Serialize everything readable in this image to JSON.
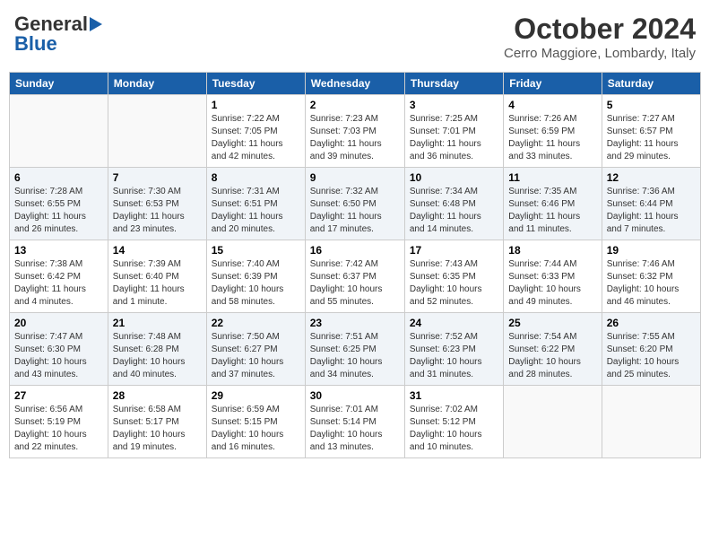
{
  "logo": {
    "general": "General",
    "blue": "Blue"
  },
  "title": "October 2024",
  "subtitle": "Cerro Maggiore, Lombardy, Italy",
  "days_header": [
    "Sunday",
    "Monday",
    "Tuesday",
    "Wednesday",
    "Thursday",
    "Friday",
    "Saturday"
  ],
  "weeks": [
    [
      {
        "num": "",
        "info": ""
      },
      {
        "num": "",
        "info": ""
      },
      {
        "num": "1",
        "info": "Sunrise: 7:22 AM\nSunset: 7:05 PM\nDaylight: 11 hours\nand 42 minutes."
      },
      {
        "num": "2",
        "info": "Sunrise: 7:23 AM\nSunset: 7:03 PM\nDaylight: 11 hours\nand 39 minutes."
      },
      {
        "num": "3",
        "info": "Sunrise: 7:25 AM\nSunset: 7:01 PM\nDaylight: 11 hours\nand 36 minutes."
      },
      {
        "num": "4",
        "info": "Sunrise: 7:26 AM\nSunset: 6:59 PM\nDaylight: 11 hours\nand 33 minutes."
      },
      {
        "num": "5",
        "info": "Sunrise: 7:27 AM\nSunset: 6:57 PM\nDaylight: 11 hours\nand 29 minutes."
      }
    ],
    [
      {
        "num": "6",
        "info": "Sunrise: 7:28 AM\nSunset: 6:55 PM\nDaylight: 11 hours\nand 26 minutes."
      },
      {
        "num": "7",
        "info": "Sunrise: 7:30 AM\nSunset: 6:53 PM\nDaylight: 11 hours\nand 23 minutes."
      },
      {
        "num": "8",
        "info": "Sunrise: 7:31 AM\nSunset: 6:51 PM\nDaylight: 11 hours\nand 20 minutes."
      },
      {
        "num": "9",
        "info": "Sunrise: 7:32 AM\nSunset: 6:50 PM\nDaylight: 11 hours\nand 17 minutes."
      },
      {
        "num": "10",
        "info": "Sunrise: 7:34 AM\nSunset: 6:48 PM\nDaylight: 11 hours\nand 14 minutes."
      },
      {
        "num": "11",
        "info": "Sunrise: 7:35 AM\nSunset: 6:46 PM\nDaylight: 11 hours\nand 11 minutes."
      },
      {
        "num": "12",
        "info": "Sunrise: 7:36 AM\nSunset: 6:44 PM\nDaylight: 11 hours\nand 7 minutes."
      }
    ],
    [
      {
        "num": "13",
        "info": "Sunrise: 7:38 AM\nSunset: 6:42 PM\nDaylight: 11 hours\nand 4 minutes."
      },
      {
        "num": "14",
        "info": "Sunrise: 7:39 AM\nSunset: 6:40 PM\nDaylight: 11 hours\nand 1 minute."
      },
      {
        "num": "15",
        "info": "Sunrise: 7:40 AM\nSunset: 6:39 PM\nDaylight: 10 hours\nand 58 minutes."
      },
      {
        "num": "16",
        "info": "Sunrise: 7:42 AM\nSunset: 6:37 PM\nDaylight: 10 hours\nand 55 minutes."
      },
      {
        "num": "17",
        "info": "Sunrise: 7:43 AM\nSunset: 6:35 PM\nDaylight: 10 hours\nand 52 minutes."
      },
      {
        "num": "18",
        "info": "Sunrise: 7:44 AM\nSunset: 6:33 PM\nDaylight: 10 hours\nand 49 minutes."
      },
      {
        "num": "19",
        "info": "Sunrise: 7:46 AM\nSunset: 6:32 PM\nDaylight: 10 hours\nand 46 minutes."
      }
    ],
    [
      {
        "num": "20",
        "info": "Sunrise: 7:47 AM\nSunset: 6:30 PM\nDaylight: 10 hours\nand 43 minutes."
      },
      {
        "num": "21",
        "info": "Sunrise: 7:48 AM\nSunset: 6:28 PM\nDaylight: 10 hours\nand 40 minutes."
      },
      {
        "num": "22",
        "info": "Sunrise: 7:50 AM\nSunset: 6:27 PM\nDaylight: 10 hours\nand 37 minutes."
      },
      {
        "num": "23",
        "info": "Sunrise: 7:51 AM\nSunset: 6:25 PM\nDaylight: 10 hours\nand 34 minutes."
      },
      {
        "num": "24",
        "info": "Sunrise: 7:52 AM\nSunset: 6:23 PM\nDaylight: 10 hours\nand 31 minutes."
      },
      {
        "num": "25",
        "info": "Sunrise: 7:54 AM\nSunset: 6:22 PM\nDaylight: 10 hours\nand 28 minutes."
      },
      {
        "num": "26",
        "info": "Sunrise: 7:55 AM\nSunset: 6:20 PM\nDaylight: 10 hours\nand 25 minutes."
      }
    ],
    [
      {
        "num": "27",
        "info": "Sunrise: 6:56 AM\nSunset: 5:19 PM\nDaylight: 10 hours\nand 22 minutes."
      },
      {
        "num": "28",
        "info": "Sunrise: 6:58 AM\nSunset: 5:17 PM\nDaylight: 10 hours\nand 19 minutes."
      },
      {
        "num": "29",
        "info": "Sunrise: 6:59 AM\nSunset: 5:15 PM\nDaylight: 10 hours\nand 16 minutes."
      },
      {
        "num": "30",
        "info": "Sunrise: 7:01 AM\nSunset: 5:14 PM\nDaylight: 10 hours\nand 13 minutes."
      },
      {
        "num": "31",
        "info": "Sunrise: 7:02 AM\nSunset: 5:12 PM\nDaylight: 10 hours\nand 10 minutes."
      },
      {
        "num": "",
        "info": ""
      },
      {
        "num": "",
        "info": ""
      }
    ]
  ]
}
